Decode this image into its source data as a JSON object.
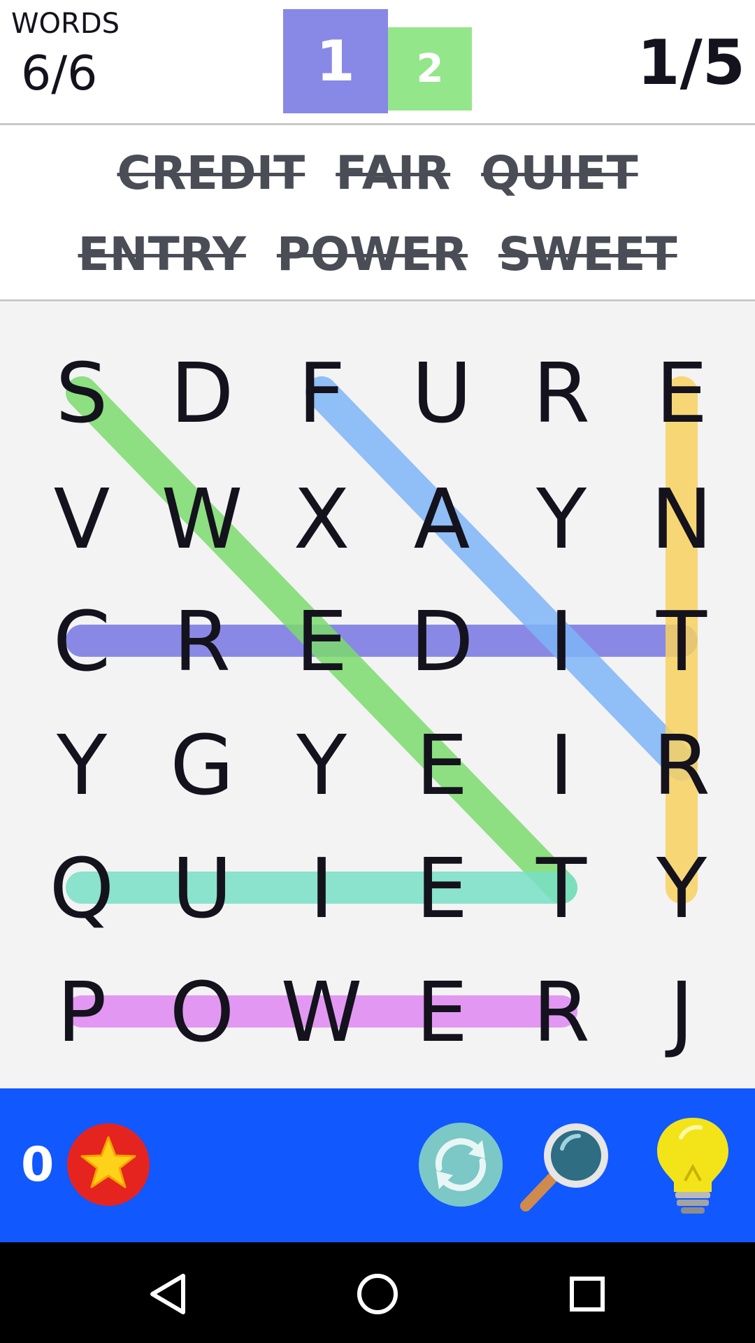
{
  "header": {
    "words_label": "WORDS",
    "words_count": "6/6",
    "levels": [
      "1",
      "2"
    ],
    "puzzle_progress": "1/5"
  },
  "word_list": {
    "row1": [
      "CREDIT",
      "FAIR",
      "QUIET"
    ],
    "row2": [
      "ENTRY",
      "POWER",
      "SWEET"
    ]
  },
  "grid": {
    "rows": [
      [
        "S",
        "D",
        "F",
        "U",
        "R",
        "E"
      ],
      [
        "V",
        "W",
        "X",
        "A",
        "Y",
        "N"
      ],
      [
        "C",
        "R",
        "E",
        "D",
        "I",
        "T"
      ],
      [
        "Y",
        "G",
        "Y",
        "E",
        "I",
        "R"
      ],
      [
        "Q",
        "U",
        "I",
        "E",
        "T",
        "Y"
      ],
      [
        "P",
        "O",
        "W",
        "E",
        "R",
        "J"
      ]
    ],
    "found": [
      {
        "word": "CREDIT",
        "from": [
          2,
          0
        ],
        "to": [
          2,
          5
        ],
        "color": "#7777e3"
      },
      {
        "word": "FAIR",
        "from": [
          0,
          2
        ],
        "to": [
          3,
          5
        ],
        "color": "#7fb5f7"
      },
      {
        "word": "ENTRY",
        "from": [
          0,
          5
        ],
        "to": [
          4,
          5
        ],
        "color": "#f8d160"
      },
      {
        "word": "SWEET",
        "from": [
          0,
          0
        ],
        "to": [
          4,
          4
        ],
        "color": "#7cdc6e"
      },
      {
        "word": "QUIET",
        "from": [
          4,
          0
        ],
        "to": [
          4,
          4
        ],
        "color": "#79e0c7"
      },
      {
        "word": "POWER",
        "from": [
          5,
          0
        ],
        "to": [
          5,
          4
        ],
        "color": "#e089f2"
      }
    ]
  },
  "toolbar": {
    "coins": "0",
    "icons": [
      "star-coin-icon",
      "shuffle-icon",
      "magnifier-icon",
      "lightbulb-icon"
    ]
  },
  "navbar": {
    "icons": [
      "back-icon",
      "home-icon",
      "recents-icon"
    ]
  },
  "colors": {
    "level_active": "#8888e6",
    "level_next": "#94e68a",
    "toolbar_bg": "#1158ff",
    "board_bg": "#f3f3f3"
  }
}
